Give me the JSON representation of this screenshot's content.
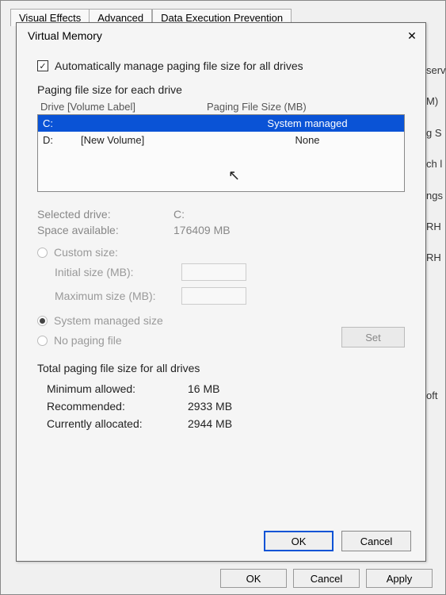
{
  "bg": {
    "tabs": [
      "Visual Effects",
      "Advanced",
      "Data Execution Prevention"
    ],
    "ok": "OK",
    "cancel": "Cancel",
    "apply": "Apply",
    "side": [
      "serv",
      "M)",
      "g S",
      "ch l",
      "ngs",
      "RH",
      "RH",
      "oft"
    ]
  },
  "dialog": {
    "title": "Virtual Memory",
    "auto_manage": "Automatically manage paging file size for all drives",
    "section": "Paging file size for each drive",
    "col_drive": "Drive  [Volume Label]",
    "col_size": "Paging File Size (MB)",
    "drives": [
      {
        "letter": "C:",
        "label": "",
        "size": "System managed",
        "selected": true
      },
      {
        "letter": "D:",
        "label": "[New Volume]",
        "size": "None",
        "selected": false
      }
    ],
    "selected_drive_lbl": "Selected drive:",
    "selected_drive_val": "C:",
    "space_lbl": "Space available:",
    "space_val": "176409 MB",
    "custom": "Custom size:",
    "initial": "Initial size (MB):",
    "maximum": "Maximum size (MB):",
    "sys_managed": "System managed size",
    "no_paging": "No paging file",
    "set": "Set",
    "totals_hdr": "Total paging file size for all drives",
    "min_lbl": "Minimum allowed:",
    "min_val": "16 MB",
    "rec_lbl": "Recommended:",
    "rec_val": "2933 MB",
    "cur_lbl": "Currently allocated:",
    "cur_val": "2944 MB",
    "ok": "OK",
    "cancel": "Cancel"
  },
  "close_glyph": "✕",
  "check_glyph": "✓"
}
